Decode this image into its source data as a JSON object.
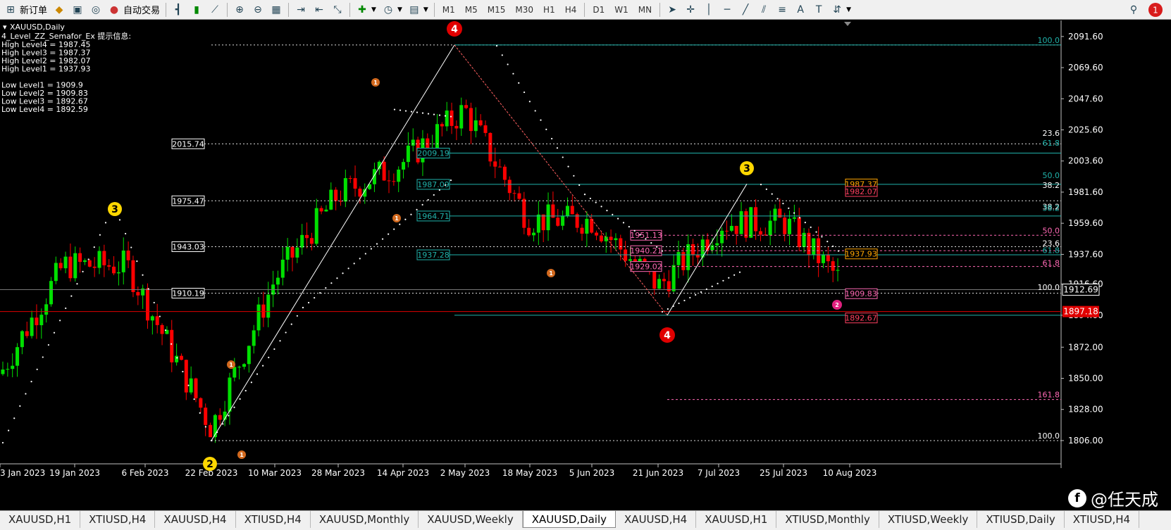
{
  "toolbar": {
    "new_order": "新订单",
    "auto_trade": "自动交易",
    "timeframes": [
      "M1",
      "M5",
      "M15",
      "M30",
      "H1",
      "H4",
      "D1",
      "W1",
      "MN"
    ],
    "notif_count": "1"
  },
  "chart": {
    "symbol": "XAUUSD,Daily",
    "indicator_title": "4_Level_ZZ_Semafor_Ex 提示信息:",
    "info_lines": [
      "High Level4 = 1987.45",
      "High Level3 = 1987.37",
      "High Level2 = 1982.07",
      "High Level1 = 1937.93",
      "",
      "Low Level1 = 1909.9",
      "Low Level2 = 1909.83",
      "Low Level3 = 1892.67",
      "Low Level4 = 1892.59"
    ],
    "price_ticks": [
      "2091.60",
      "2069.60",
      "2047.60",
      "2025.60",
      "2003.60",
      "1981.60",
      "1959.60",
      "1937.60",
      "1916.60",
      "1894.60",
      "1872.00",
      "1850.00",
      "1828.00",
      "1806.00"
    ],
    "current_price": "1912.69",
    "red_line_price": "1897.18",
    "date_ticks": [
      "3 Jan 2023",
      "19 Jan 2023",
      "6 Feb 2023",
      "22 Feb 2023",
      "10 Mar 2023",
      "28 Mar 2023",
      "14 Apr 2023",
      "2 May 2023",
      "18 May 2023",
      "5 Jun 2023",
      "21 Jun 2023",
      "7 Jul 2023",
      "25 Jul 2023",
      "10 Aug 2023"
    ],
    "white_level_labels": [
      "2015.74",
      "1975.47",
      "1943.03",
      "1910.19"
    ],
    "cyan_level_labels": [
      "2009.19",
      "1987.09",
      "1964.71",
      "1937.28"
    ],
    "pink_level_labels": [
      "1951.13",
      "1940.21",
      "1929.02"
    ],
    "right_level_labels": [
      "1987.37",
      "1982.07",
      "1937.93",
      "1909.83",
      "1892.67"
    ],
    "fib_labels": [
      "100.0",
      "23.6",
      "61.8",
      "50.0",
      "38.2",
      "38.2",
      "38.2",
      "50.0",
      "23.6",
      "61.8",
      "61.8",
      "100.0",
      "161.8",
      "100.0"
    ],
    "semafor_labels": [
      "4",
      "3",
      "3",
      "4",
      "2",
      "2",
      "1",
      "1",
      "1",
      "1",
      "1"
    ]
  },
  "chart_data": {
    "type": "candlestick",
    "title": "XAUUSD,Daily",
    "ylim": [
      1800,
      2097
    ],
    "x": [
      "3 Jan 2023",
      "19 Jan 2023",
      "6 Feb 2023",
      "22 Feb 2023",
      "10 Mar 2023",
      "28 Mar 2023",
      "14 Apr 2023",
      "2 May 2023",
      "18 May 2023",
      "5 Jun 2023",
      "21 Jun 2023",
      "7 Jul 2023",
      "25 Jul 2023",
      "10 Aug 2023"
    ],
    "close": [
      1853,
      1930,
      1930,
      1815,
      1920,
      1980,
      2002,
      2040,
      1962,
      1962,
      1915,
      1960,
      1960,
      1912.69
    ],
    "colors": {
      "bull": "#00e000",
      "bear": "#ff0000",
      "background": "#000000",
      "cyan_line": "#20b2aa",
      "pink_line": "#ff69b4"
    }
  },
  "tabs": [
    "XAUUSD,H1",
    "XTIUSD,H4",
    "XAUUSD,H4",
    "XTIUSD,H4",
    "XAUUSD,Monthly",
    "XAUUSD,Weekly",
    "XAUUSD,Daily",
    "XAUUSD,H4",
    "XAUUSD,H1",
    "XTIUSD,Monthly",
    "XTIUSD,Weekly",
    "XTIUSD,Daily",
    "XTIUSD,H4"
  ],
  "active_tab": "XAUUSD,Daily",
  "watermark": {
    "logo": "f",
    "text": "@任天成"
  }
}
